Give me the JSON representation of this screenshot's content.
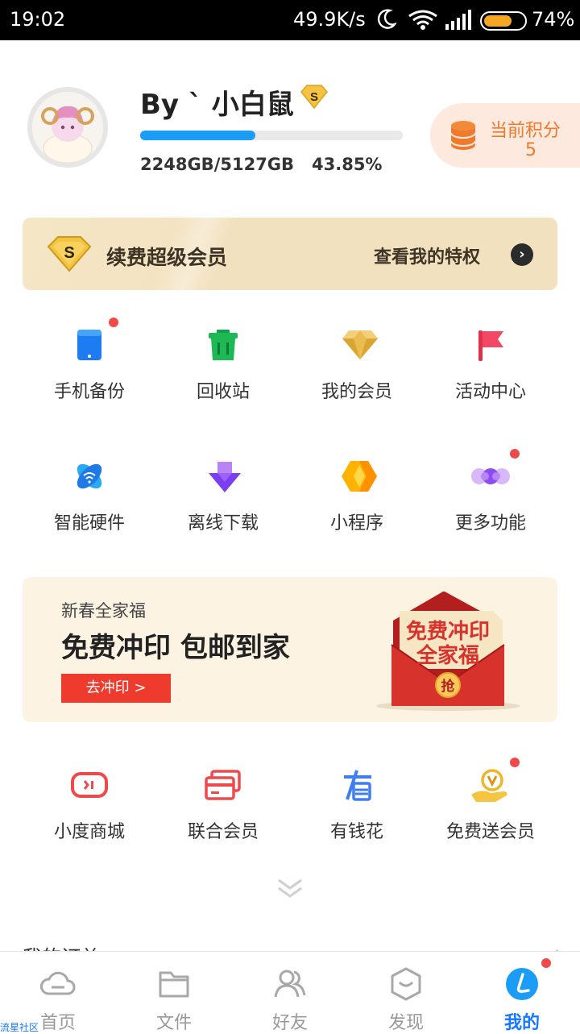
{
  "status_bar": {
    "time": "19:02",
    "network_speed": "49.9K/s",
    "battery_percent": "74%",
    "battery_level": 0.74
  },
  "profile": {
    "username": "By ` 小白鼠",
    "vip_badge_letter": "S",
    "quota_text": "2248GB/5127GB",
    "quota_percent_text": "43.85%",
    "quota_fraction": 0.4385,
    "points_label": "当前积分",
    "points_value": "5"
  },
  "renew_banner": {
    "badge_letter": "S",
    "title": "续费超级会员",
    "link_label": "查看我的特权",
    "arrow": "›"
  },
  "grid_row1": [
    {
      "label": "手机备份",
      "icon": "phone-backup-icon",
      "dot": true
    },
    {
      "label": "回收站",
      "icon": "recycle-bin-icon",
      "dot": false
    },
    {
      "label": "我的会员",
      "icon": "diamond-icon",
      "dot": false
    },
    {
      "label": "活动中心",
      "icon": "flag-icon",
      "dot": false
    }
  ],
  "grid_row2": [
    {
      "label": "智能硬件",
      "icon": "smart-hardware-icon",
      "dot": false
    },
    {
      "label": "离线下载",
      "icon": "offline-download-icon",
      "dot": false
    },
    {
      "label": "小程序",
      "icon": "mini-program-icon",
      "dot": false
    },
    {
      "label": "更多功能",
      "icon": "more-functions-icon",
      "dot": true
    }
  ],
  "print_banner": {
    "subtitle": "新春全家福",
    "title": "免费冲印 包邮到家",
    "button_label": "去冲印 >",
    "art_line1": "免费冲印",
    "art_line2": "全家福",
    "art_seal": "抢"
  },
  "grid_row3": [
    {
      "label": "小度商城",
      "icon": "xiaodu-mall-icon",
      "dot": false
    },
    {
      "label": "联合会员",
      "icon": "joint-membership-icon",
      "dot": false
    },
    {
      "label": "有钱花",
      "icon": "youqianhua-icon",
      "dot": false
    },
    {
      "label": "免费送会员",
      "icon": "free-membership-icon",
      "dot": true
    }
  ],
  "partial_section": {
    "title": "我的订单"
  },
  "bottom_nav": [
    {
      "label": "首页",
      "icon": "home-cloud-icon",
      "active": false
    },
    {
      "label": "文件",
      "icon": "folder-icon",
      "active": false
    },
    {
      "label": "好友",
      "icon": "friends-icon",
      "active": false
    },
    {
      "label": "发现",
      "icon": "discover-icon",
      "active": false
    },
    {
      "label": "我的",
      "icon": "me-icon",
      "active": true
    }
  ],
  "watermark": "流星社区",
  "colors": {
    "accent_blue": "#1a9cf7",
    "points_orange": "#f07a2c",
    "notification_red": "#f0494a",
    "active_nav_blue": "#1677ff"
  }
}
